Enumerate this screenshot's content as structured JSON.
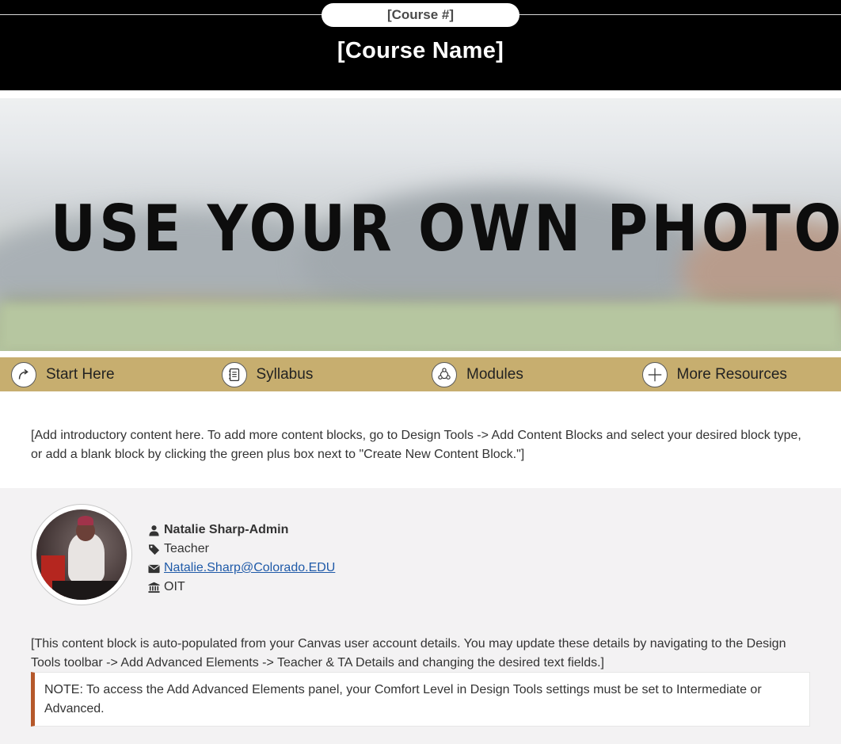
{
  "header": {
    "course_number": "[Course #]",
    "course_name": "[Course Name]"
  },
  "banner": {
    "placeholder_text": "USE YOUR OWN PHOTO HERE"
  },
  "nav": {
    "items": [
      {
        "label": "Start Here",
        "icon": "arrow-redo-icon"
      },
      {
        "label": "Syllabus",
        "icon": "notebook-icon"
      },
      {
        "label": "Modules",
        "icon": "modules-icon"
      },
      {
        "label": "More Resources",
        "icon": "plus-icon"
      }
    ],
    "accent_color": "#c7ae6f"
  },
  "intro": {
    "text": "[Add introductory content here. To add more content blocks, go to Design Tools -> Add Content Blocks and select your desired block type, or add a blank block by clicking the green plus box next to \"Create New Content Block.\"]"
  },
  "teacher": {
    "name": "Natalie Sharp-Admin",
    "role": "Teacher",
    "email": "Natalie.Sharp@Colorado.EDU",
    "department": "OIT",
    "auto_note": "[This content block is auto-populated from your Canvas user account details. You may update these details by navigating to the Design Tools toolbar -> Add Advanced Elements -> Teacher & TA Details and changing the desired text fields.]",
    "callout": "NOTE: To access the Add Advanced Elements panel, your Comfort Level in Design Tools settings must be set to Intermediate or Advanced.",
    "callout_border_color": "#b5582a"
  }
}
